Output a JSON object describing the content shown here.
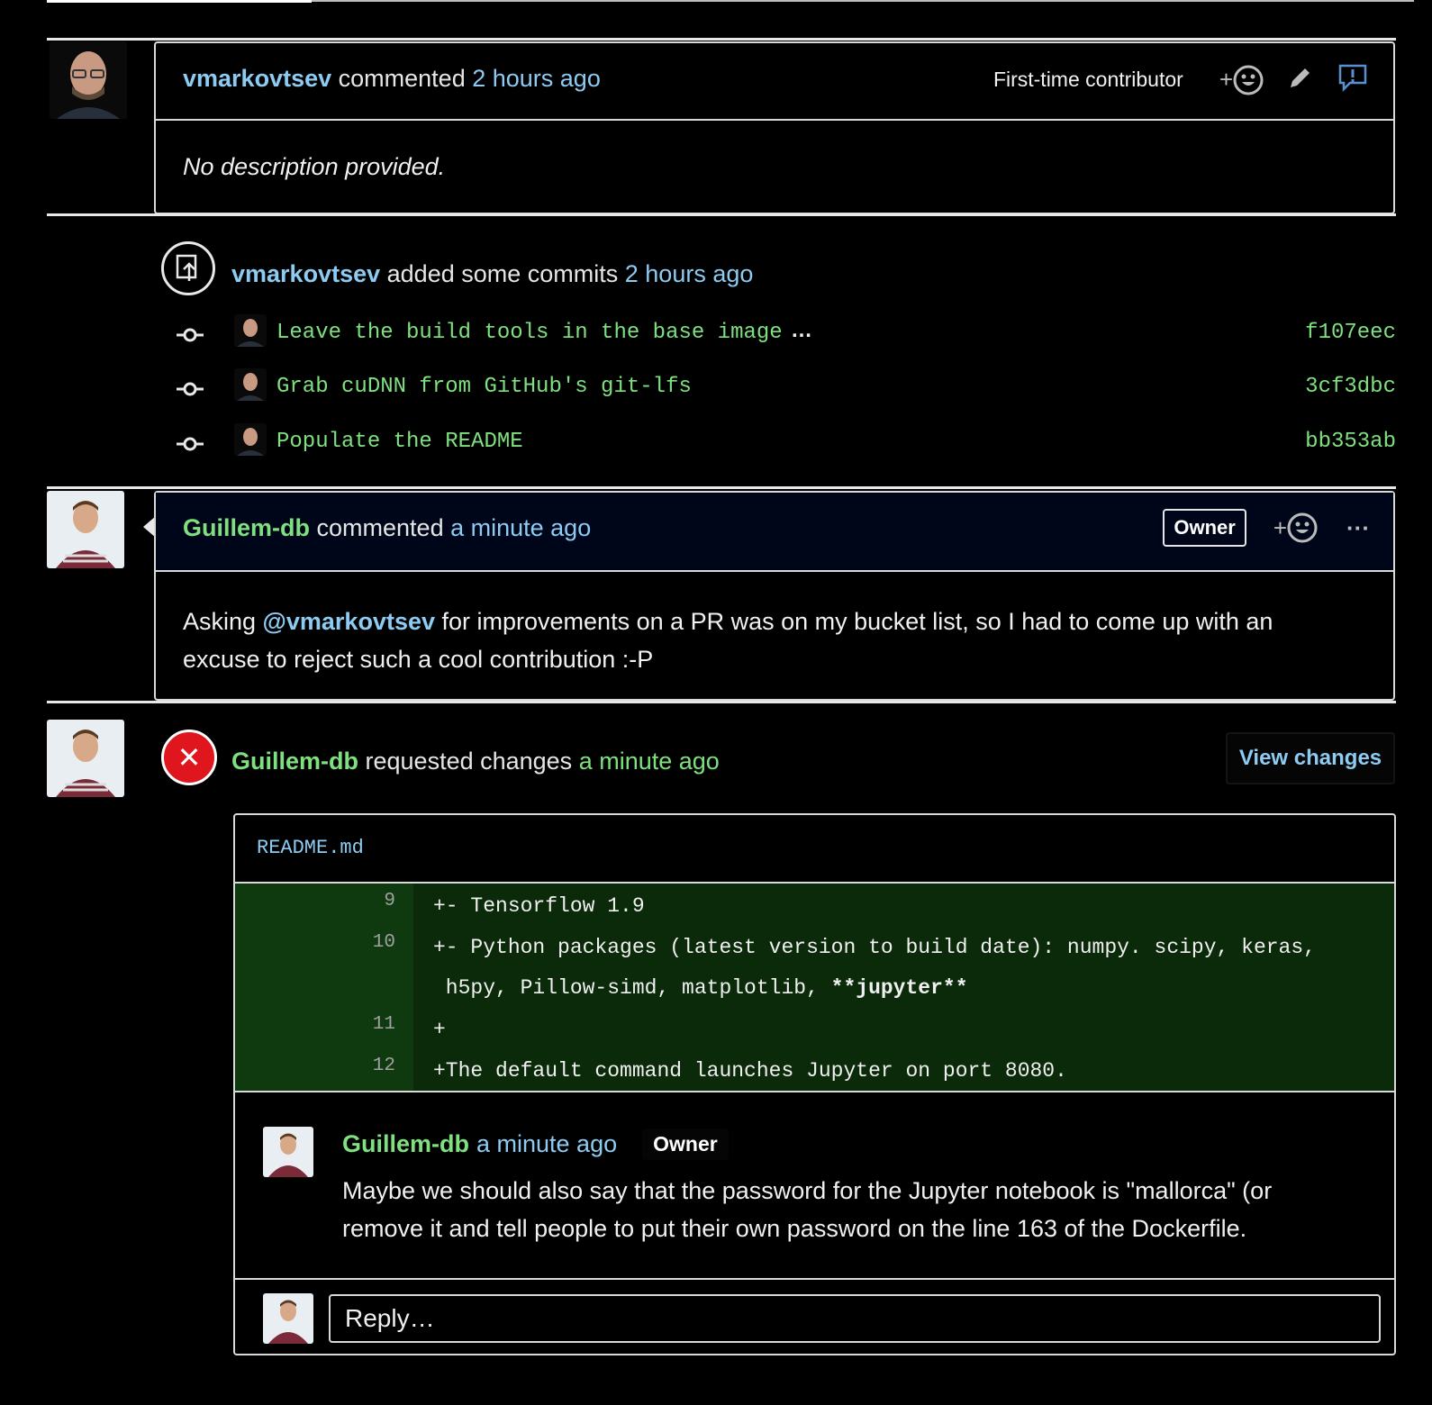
{
  "comment1": {
    "author": "vmarkovtsev",
    "action": "commented",
    "time": "2 hours ago",
    "badge": "First-time contributor",
    "body": "No description provided."
  },
  "commits_event": {
    "author": "vmarkovtsev",
    "action": "added some commits",
    "time": "2 hours ago",
    "commits": [
      {
        "message": "Leave the build tools in the base image",
        "sha": "f107eec",
        "more": "…"
      },
      {
        "message": "Grab cuDNN from GitHub's git-lfs",
        "sha": "3cf3dbc"
      },
      {
        "message": "Populate the README",
        "sha": "bb353ab"
      }
    ]
  },
  "comment2": {
    "author": "Guillem-db",
    "action": "commented",
    "time": "a minute ago",
    "badge": "Owner",
    "more": "···",
    "body_pre": "Asking ",
    "mention": "@vmarkovtsev",
    "body_post": " for improvements on a PR was on my bucket list, so I had to come up with an",
    "body_line2": "excuse to reject such a cool contribution :-P"
  },
  "review": {
    "author": "Guillem-db",
    "action": "requested changes",
    "time": "a minute ago",
    "view_changes": "View changes",
    "file": "README.md",
    "diff": [
      {
        "ln": "9",
        "code": "+- Tensorflow 1.9"
      },
      {
        "ln": "10",
        "code": "+- Python packages (latest version to build date): numpy. scipy, keras,"
      },
      {
        "ln": "",
        "code": " h5py, Pillow-simd, matplotlib, ",
        "bold": "**jupyter**"
      },
      {
        "ln": "11",
        "code": "+"
      },
      {
        "ln": "12",
        "code": "+The default command launches Jupyter on port 8080."
      }
    ],
    "inline_comment": {
      "author": "Guillem-db",
      "time": "a minute ago",
      "badge": "Owner",
      "line1": "Maybe we should also say that the password for the Jupyter notebook is \"mallorca\" (or",
      "line2": "remove it and tell people to put their own password on the line 163 of the Dockerfile."
    },
    "reply_placeholder": "Reply…"
  },
  "colors": {
    "link_blue": "#8dcbf2",
    "link_green": "#7ee07f",
    "danger": "#e0161e",
    "diff_bg": "#0a2a0a"
  }
}
